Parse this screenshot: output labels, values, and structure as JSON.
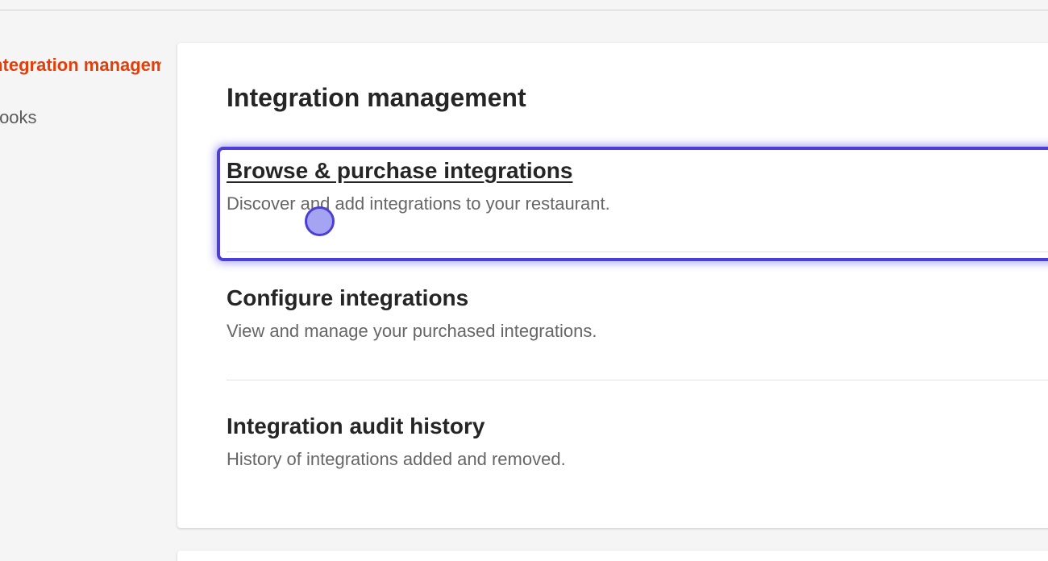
{
  "side_nav": {
    "items": [
      {
        "label": "Integration management",
        "active": true
      },
      {
        "label": "Webhooks",
        "active": false
      }
    ]
  },
  "main": {
    "title": "Integration management",
    "options": [
      {
        "title": "Browse & purchase integrations",
        "description": "Discover and add integrations to your restaurant.",
        "focused": true
      },
      {
        "title": "Configure integrations",
        "description": "View and manage your purchased integrations.",
        "focused": false
      },
      {
        "title": "Integration audit history",
        "description": "History of integrations added and removed.",
        "focused": false
      }
    ]
  },
  "colors": {
    "accent": "#e0400b",
    "focus": "#4b3fd6",
    "background": "#f5f5f5"
  }
}
